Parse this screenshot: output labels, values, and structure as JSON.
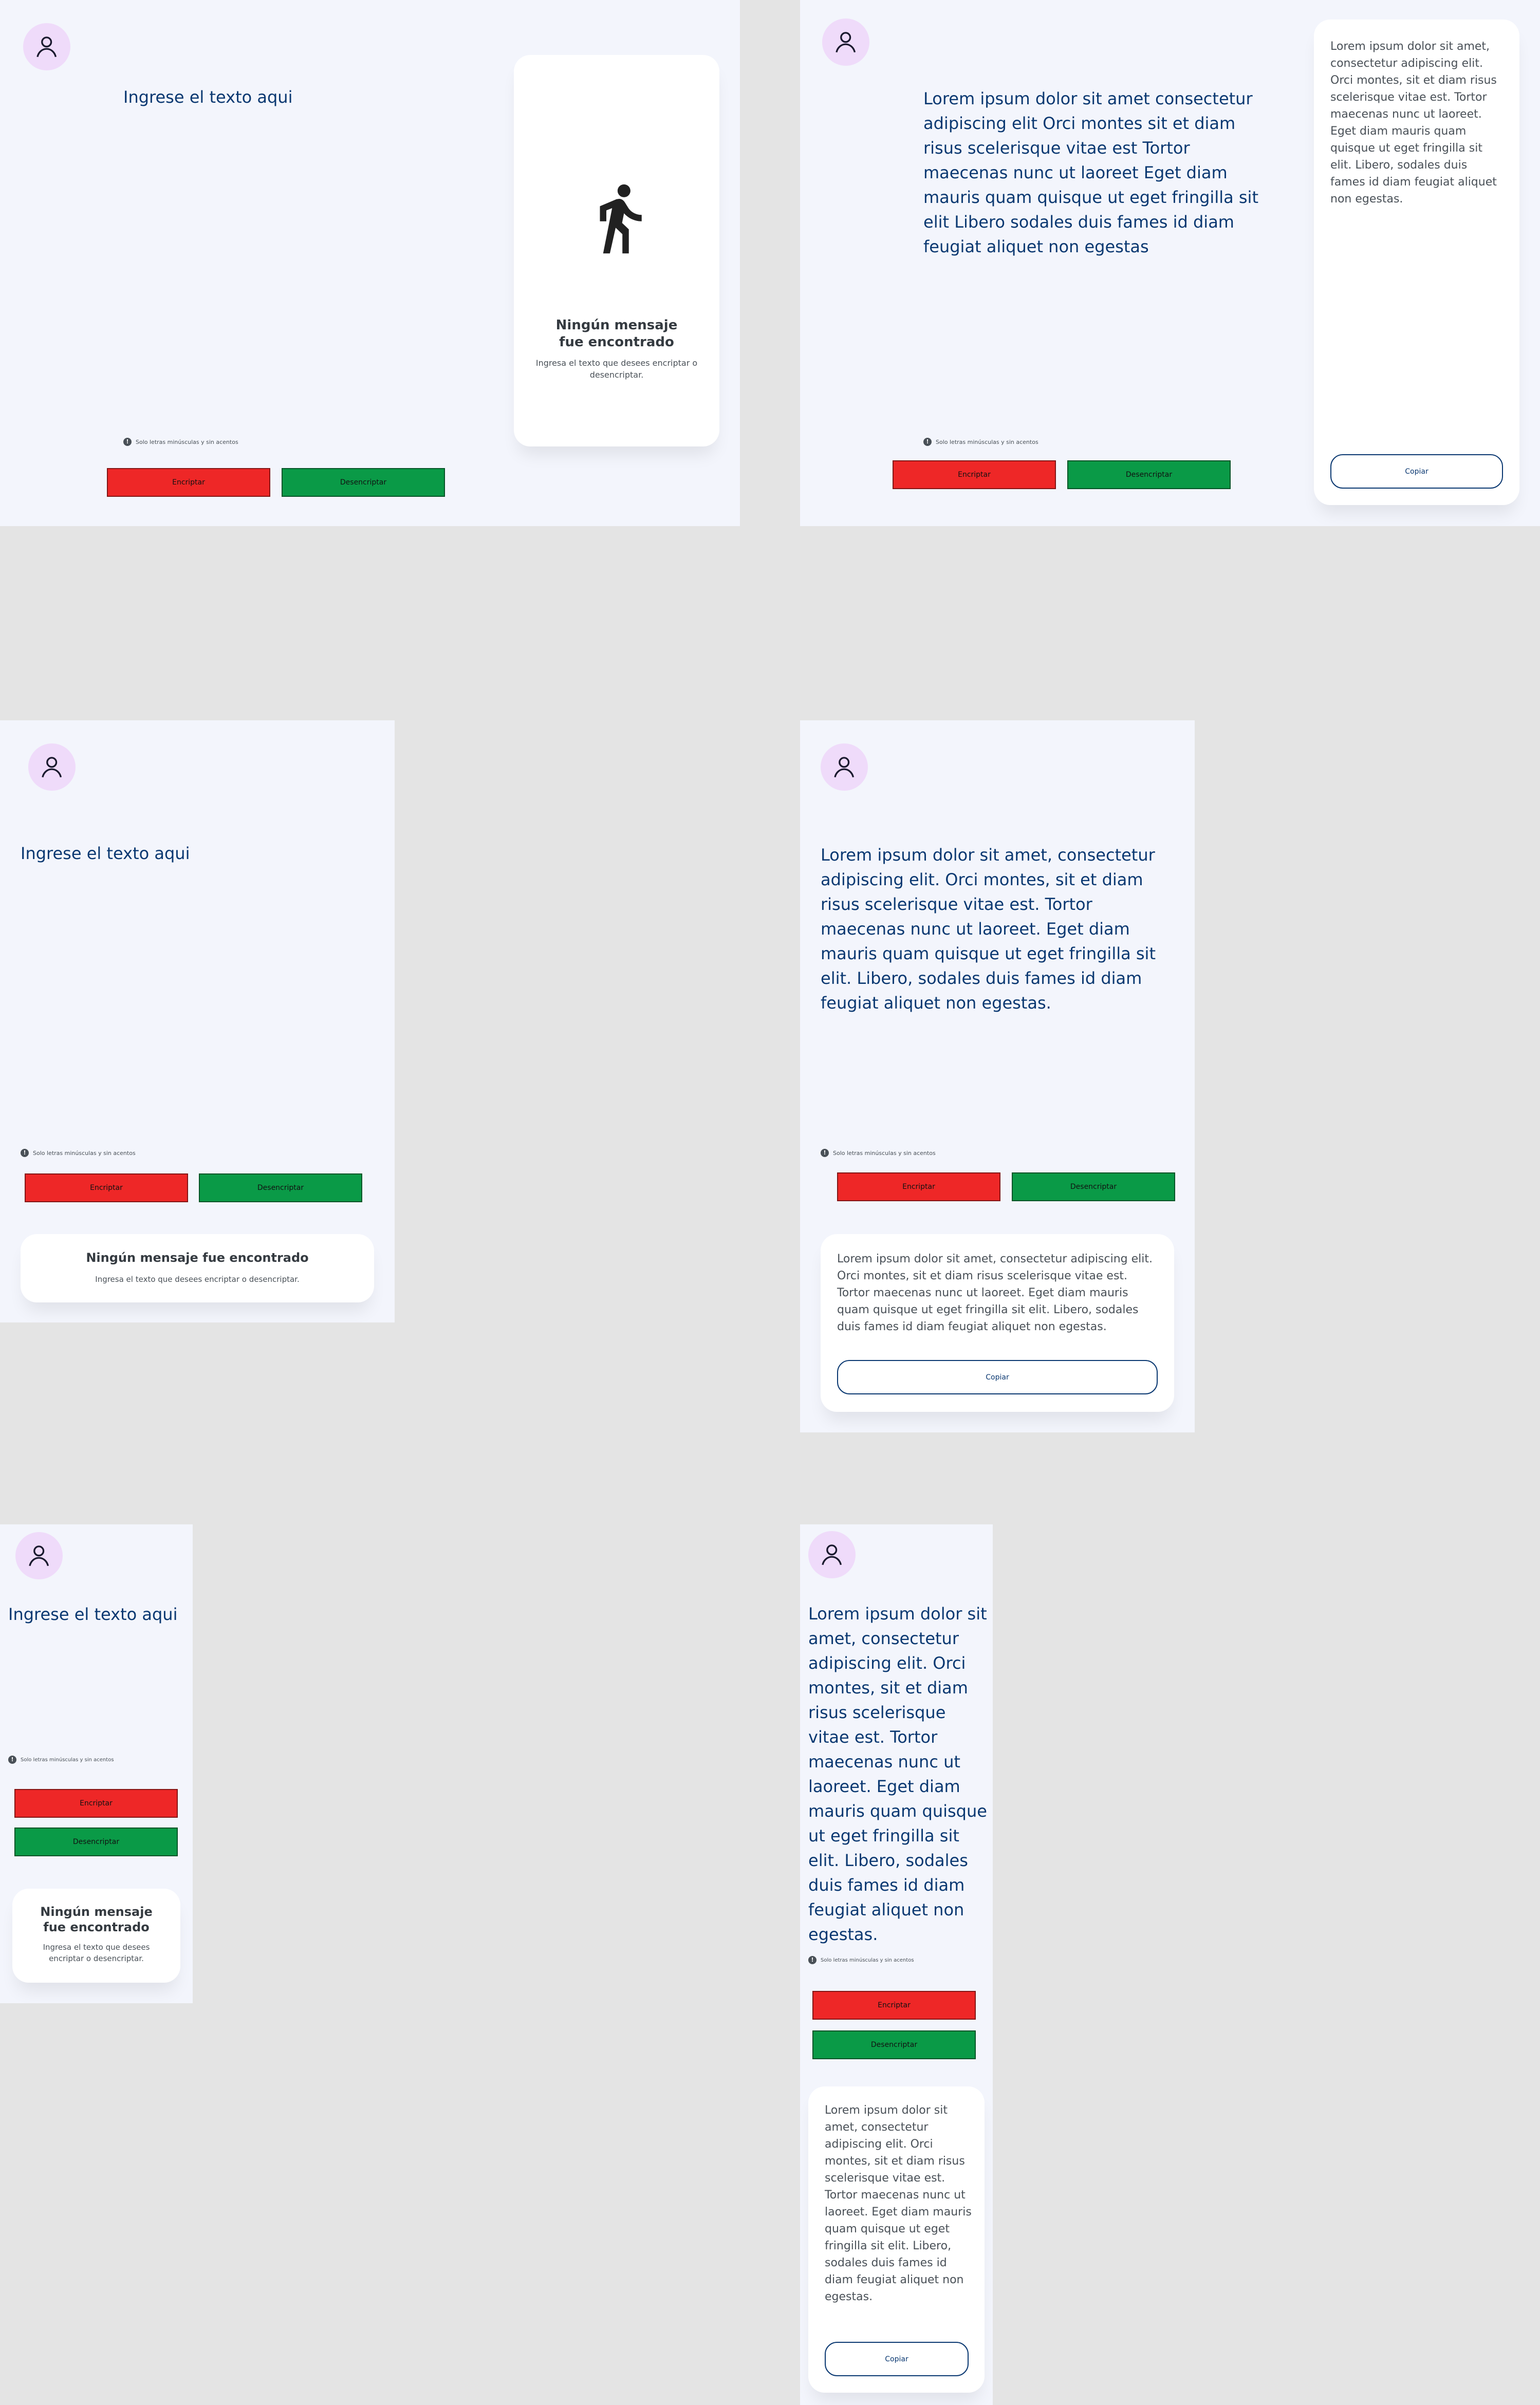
{
  "ui": {
    "placeholder": "Ingrese el texto aqui",
    "hint": "Solo letras minúsculas y sin acentos",
    "encrypt_label": "Encriptar",
    "decrypt_label": "Desencriptar",
    "empty_title": "Ningún mensaje fue encontrado",
    "empty_subtitle": "Ingresa el texto que desees encriptar o desencriptar.",
    "copy_label": "Copiar",
    "input_text_nocomma": "Lorem ipsum dolor sit amet consectetur adipiscing elit Orci montes sit et diam risus scelerisque vitae est Tortor maecenas nunc ut laoreet Eget diam mauris quam quisque ut eget fringilla sit elit Libero sodales duis fames id diam feugiat aliquet non egestas",
    "input_text": "Lorem ipsum dolor sit amet, consectetur adipiscing elit. Orci montes, sit et diam risus scelerisque vitae est. Tortor maecenas nunc ut laoreet. Eget diam mauris quam quisque ut eget fringilla sit elit. Libero, sodales duis fames id diam feugiat aliquet non egestas.",
    "output_text": "Lorem ipsum dolor sit amet, consectetur adipiscing elit. Orci montes, sit et diam risus scelerisque vitae est. Tortor maecenas nunc ut laoreet. Eget diam mauris quam quisque ut eget fringilla sit elit. Libero, sodales duis fames id diam feugiat aliquet non egestas."
  },
  "icons": [
    "user-avatar-icon",
    "walking-person-icon",
    "info-icon"
  ],
  "colors": {
    "page_bg": "#e4e4e4",
    "frame_bg": "#f3f5fc",
    "avatar_bg": "#efdbfa",
    "text_primary": "#0a3871",
    "encrypt_button": "#ee2727",
    "decrypt_button": "#0a9a47",
    "card_bg": "#ffffff"
  }
}
